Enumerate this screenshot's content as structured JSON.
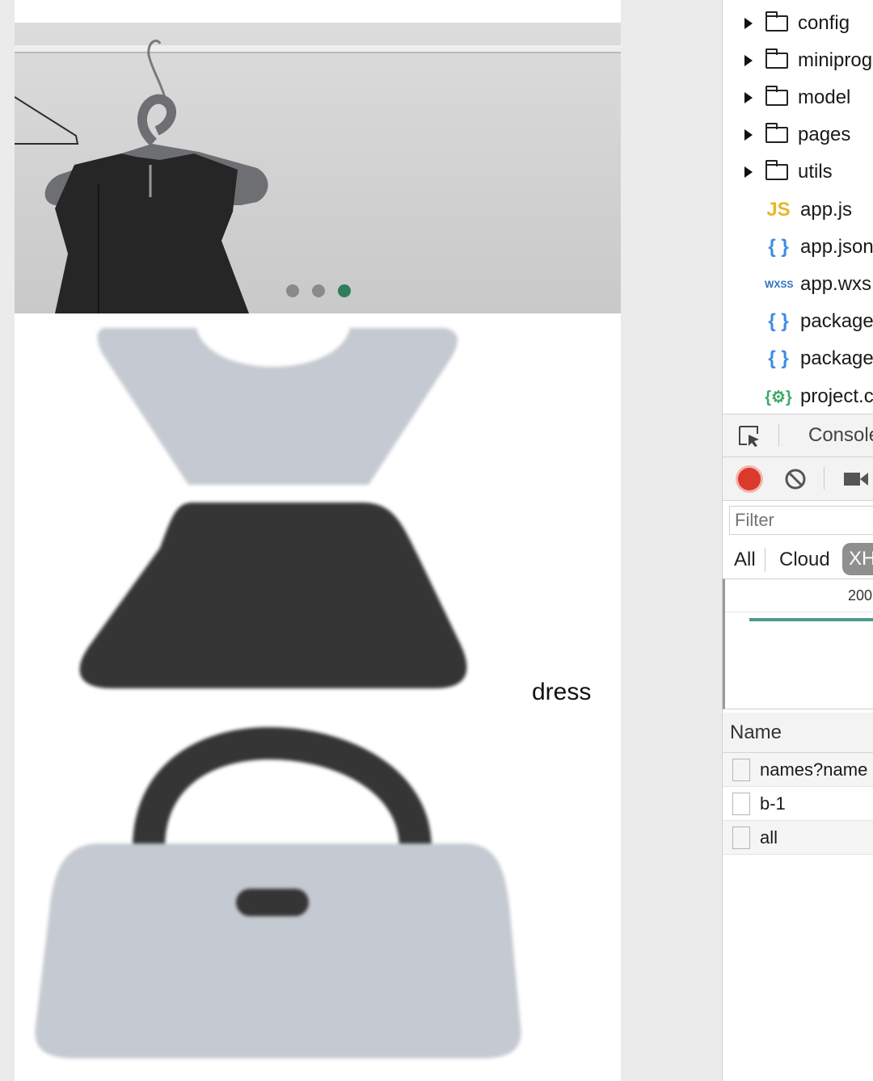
{
  "simulator": {
    "carousel": {
      "dot_count": 3,
      "active_index": 2
    },
    "categories": [
      {
        "label": "dress",
        "icon": "dress-icon"
      },
      {
        "label": "",
        "icon": "handbag-icon"
      }
    ]
  },
  "devtools": {
    "file_tree": [
      {
        "type": "folder",
        "name": "config"
      },
      {
        "type": "folder",
        "name": "miniprog"
      },
      {
        "type": "folder",
        "name": "model"
      },
      {
        "type": "folder",
        "name": "pages"
      },
      {
        "type": "folder",
        "name": "utils"
      },
      {
        "type": "file",
        "badge": "JS",
        "name": "app.js"
      },
      {
        "type": "file",
        "badge": "{ }",
        "name": "app.json"
      },
      {
        "type": "file",
        "badge": "WXSS",
        "name": "app.wxs"
      },
      {
        "type": "file",
        "badge": "{ }",
        "name": "package"
      },
      {
        "type": "file",
        "badge": "{ }",
        "name": "package"
      },
      {
        "type": "file",
        "badge": "{⚙}",
        "name": "project.c"
      }
    ],
    "panel_tabs": {
      "console": "Console"
    },
    "filter_placeholder": "Filter",
    "type_filters": [
      "All",
      "Cloud",
      "XH"
    ],
    "timeline_tick": "200",
    "table_header": "Name",
    "requests": [
      "names?name",
      "b-1",
      "all"
    ],
    "colors": {
      "record": "#d93a2b",
      "carousel_active": "#2e7d5b",
      "icon_light": "#c5c9d1",
      "icon_dark": "#353535",
      "js_badge": "#e8b62c",
      "json_badge": "#3f8ee0",
      "wxss_badge": "#2c6fbf",
      "project_badge": "#3ea86a"
    }
  }
}
